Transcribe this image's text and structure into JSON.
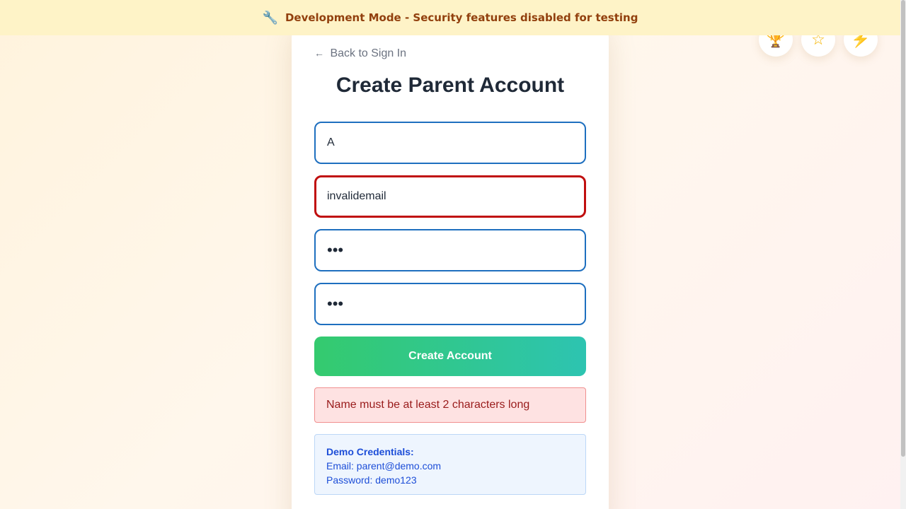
{
  "banner": {
    "icon": "wrench-icon",
    "icon_glyph": "🔧",
    "text": "Development Mode - Security features disabled for testing"
  },
  "top_icons": [
    {
      "name": "trophy-icon",
      "glyph": "🏆"
    },
    {
      "name": "star-icon",
      "glyph": "☆"
    },
    {
      "name": "lightning-icon",
      "glyph": "⚡"
    }
  ],
  "form": {
    "back_arrow": "←",
    "back_label": "Back to Sign In",
    "title": "Create Parent Account",
    "name_value": "A",
    "email_value": "invalidemail",
    "password_value": "•••",
    "confirm_password_value": "•••",
    "submit_label": "Create Account",
    "error_message": "Name must be at least 2 characters long"
  },
  "demo": {
    "heading": "Demo Credentials:",
    "email_line": "Email: parent@demo.com",
    "password_line": "Password: demo123"
  },
  "colors": {
    "banner_bg": "#fef3c7",
    "banner_text": "#92400e",
    "field_border": "#1e6fbf",
    "error_border": "#c00f0f",
    "button_gradient_start": "#34ca6e",
    "button_gradient_end": "#2dc4b1",
    "error_bg": "#fee2e2",
    "demo_text": "#1d4ed8"
  }
}
